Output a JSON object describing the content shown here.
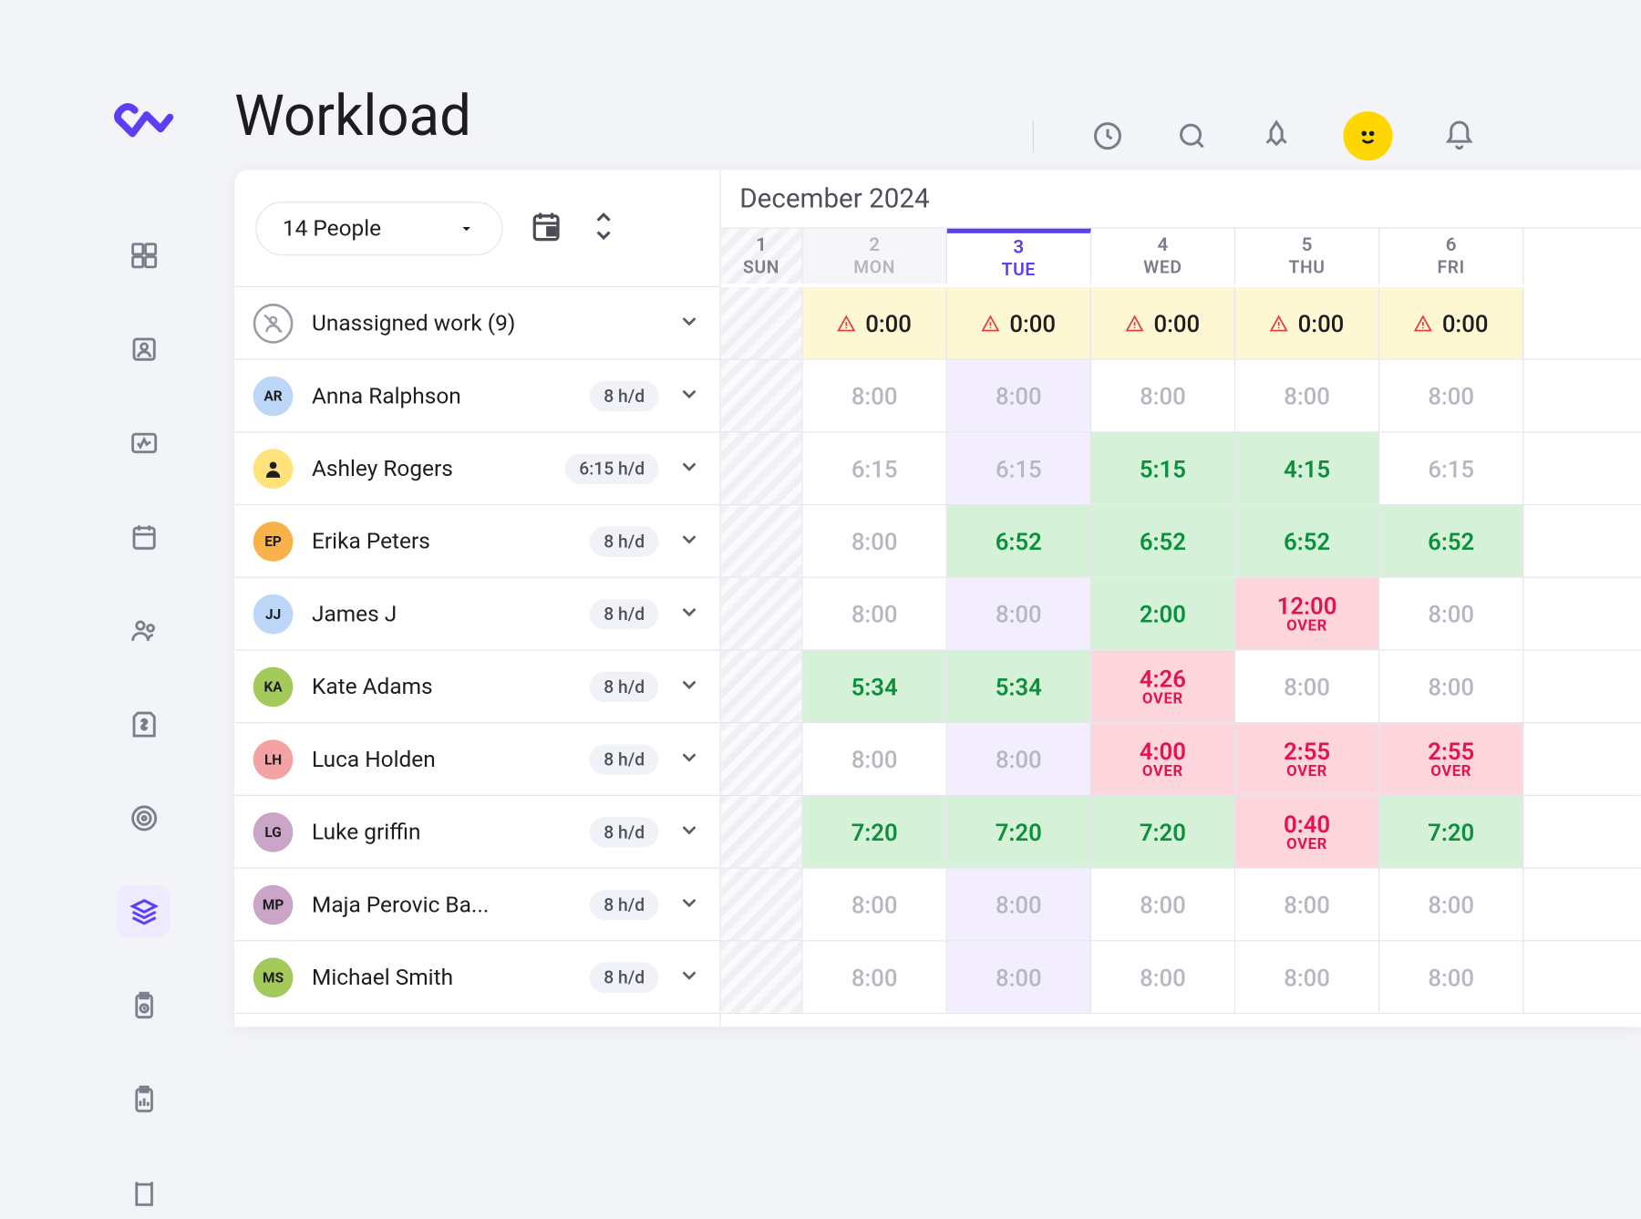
{
  "page_title": "Workload",
  "month_label": "December 2024",
  "people_selector_label": "14 People",
  "over_label": "OVER",
  "days": [
    {
      "num": "1",
      "dow": "SUN",
      "kind": "hatched"
    },
    {
      "num": "2",
      "dow": "MON",
      "kind": "past"
    },
    {
      "num": "3",
      "dow": "TUE",
      "kind": "today"
    },
    {
      "num": "4",
      "dow": "WED",
      "kind": ""
    },
    {
      "num": "5",
      "dow": "THU",
      "kind": ""
    },
    {
      "num": "6",
      "dow": "FRI",
      "kind": ""
    }
  ],
  "unassigned": {
    "label": "Unassigned work (9)",
    "cells": [
      {
        "t": "warn",
        "v": "0:00"
      },
      {
        "t": "warn",
        "v": "0:00"
      },
      {
        "t": "warn",
        "v": "0:00"
      },
      {
        "t": "warn",
        "v": "0:00"
      },
      {
        "t": "warn",
        "v": "0:00"
      }
    ]
  },
  "people": [
    {
      "initials": "AR",
      "color": "#bcd6f8",
      "name": "Anna Ralphson",
      "cap": "8 h/d",
      "cells": [
        {
          "t": "empty",
          "v": "8:00"
        },
        {
          "t": "highlight",
          "v": "8:00"
        },
        {
          "t": "empty",
          "v": "8:00"
        },
        {
          "t": "empty",
          "v": "8:00"
        },
        {
          "t": "empty",
          "v": "8:00"
        }
      ]
    },
    {
      "initials": "",
      "color": "#ffe27a",
      "icon": true,
      "name": "Ashley Rogers",
      "cap": "6:15 h/d",
      "cells": [
        {
          "t": "empty",
          "v": "6:15"
        },
        {
          "t": "highlight",
          "v": "6:15"
        },
        {
          "t": "good",
          "v": "5:15"
        },
        {
          "t": "good",
          "v": "4:15"
        },
        {
          "t": "empty",
          "v": "6:15"
        }
      ]
    },
    {
      "initials": "EP",
      "color": "#f7b24a",
      "name": "Erika Peters",
      "cap": "8 h/d",
      "cells": [
        {
          "t": "empty",
          "v": "8:00"
        },
        {
          "t": "good",
          "v": "6:52"
        },
        {
          "t": "good",
          "v": "6:52"
        },
        {
          "t": "good",
          "v": "6:52"
        },
        {
          "t": "good",
          "v": "6:52"
        }
      ]
    },
    {
      "initials": "JJ",
      "color": "#bcd6f8",
      "name": "James J",
      "cap": "8 h/d",
      "cells": [
        {
          "t": "empty",
          "v": "8:00"
        },
        {
          "t": "highlight",
          "v": "8:00"
        },
        {
          "t": "good",
          "v": "2:00"
        },
        {
          "t": "over",
          "v": "12:00"
        },
        {
          "t": "empty",
          "v": "8:00"
        }
      ]
    },
    {
      "initials": "KA",
      "color": "#a2c95a",
      "name": "Kate Adams",
      "cap": "8 h/d",
      "cells": [
        {
          "t": "good",
          "v": "5:34"
        },
        {
          "t": "good",
          "v": "5:34"
        },
        {
          "t": "over",
          "v": "4:26"
        },
        {
          "t": "empty",
          "v": "8:00"
        },
        {
          "t": "empty",
          "v": "8:00"
        }
      ]
    },
    {
      "initials": "LH",
      "color": "#f3a3a3",
      "name": "Luca Holden",
      "cap": "8 h/d",
      "cells": [
        {
          "t": "empty",
          "v": "8:00"
        },
        {
          "t": "highlight",
          "v": "8:00"
        },
        {
          "t": "over",
          "v": "4:00"
        },
        {
          "t": "over",
          "v": "2:55"
        },
        {
          "t": "over",
          "v": "2:55"
        }
      ]
    },
    {
      "initials": "LG",
      "color": "#cba5c7",
      "name": "Luke griffin",
      "cap": "8 h/d",
      "cells": [
        {
          "t": "good",
          "v": "7:20"
        },
        {
          "t": "good",
          "v": "7:20"
        },
        {
          "t": "good",
          "v": "7:20"
        },
        {
          "t": "over",
          "v": "0:40"
        },
        {
          "t": "good",
          "v": "7:20"
        }
      ]
    },
    {
      "initials": "MP",
      "color": "#cba5c7",
      "name": "Maja Perovic Ba...",
      "cap": "8 h/d",
      "cells": [
        {
          "t": "empty",
          "v": "8:00"
        },
        {
          "t": "highlight",
          "v": "8:00"
        },
        {
          "t": "empty",
          "v": "8:00"
        },
        {
          "t": "empty",
          "v": "8:00"
        },
        {
          "t": "empty",
          "v": "8:00"
        }
      ]
    },
    {
      "initials": "MS",
      "color": "#a2c95a",
      "name": "Michael Smith",
      "cap": "8 h/d",
      "cells": [
        {
          "t": "empty",
          "v": "8:00"
        },
        {
          "t": "highlight",
          "v": "8:00"
        },
        {
          "t": "empty",
          "v": "8:00"
        },
        {
          "t": "empty",
          "v": "8:00"
        },
        {
          "t": "empty",
          "v": "8:00"
        }
      ]
    }
  ]
}
